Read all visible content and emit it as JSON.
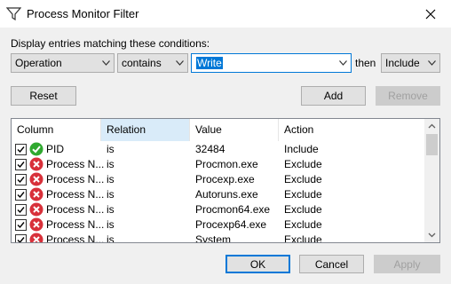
{
  "window": {
    "title": "Process Monitor Filter"
  },
  "condition": {
    "label": "Display entries matching these conditions:",
    "column": "Operation",
    "relation": "contains",
    "value": "Write",
    "then_label": "then",
    "action": "Include"
  },
  "buttons": {
    "reset": "Reset",
    "add": "Add",
    "remove": "Remove",
    "ok": "OK",
    "cancel": "Cancel",
    "apply": "Apply"
  },
  "table": {
    "headers": [
      "Column",
      "Relation",
      "Value",
      "Action"
    ],
    "rows": [
      {
        "column": "PID",
        "relation": "is",
        "value": "32484",
        "action": "Include",
        "status": "include",
        "checked": true
      },
      {
        "column": "Process N...",
        "relation": "is",
        "value": "Procmon.exe",
        "action": "Exclude",
        "status": "exclude",
        "checked": true
      },
      {
        "column": "Process N...",
        "relation": "is",
        "value": "Procexp.exe",
        "action": "Exclude",
        "status": "exclude",
        "checked": true
      },
      {
        "column": "Process N...",
        "relation": "is",
        "value": "Autoruns.exe",
        "action": "Exclude",
        "status": "exclude",
        "checked": true
      },
      {
        "column": "Process N...",
        "relation": "is",
        "value": "Procmon64.exe",
        "action": "Exclude",
        "status": "exclude",
        "checked": true
      },
      {
        "column": "Process N...",
        "relation": "is",
        "value": "Procexp64.exe",
        "action": "Exclude",
        "status": "exclude",
        "checked": true
      },
      {
        "column": "Process N...",
        "relation": "is",
        "value": "System",
        "action": "Exclude",
        "status": "exclude",
        "checked": true
      }
    ]
  },
  "colors": {
    "accent": "#0078d7",
    "include_green": "#2fa82f",
    "exclude_red": "#d8303a",
    "sorted_header": "#d9ebf9"
  },
  "icons": {
    "app": "filter-icon",
    "close": "close-icon",
    "include": "check-circle-icon",
    "exclude": "x-circle-icon",
    "dropdown": "chevron-down-icon"
  }
}
